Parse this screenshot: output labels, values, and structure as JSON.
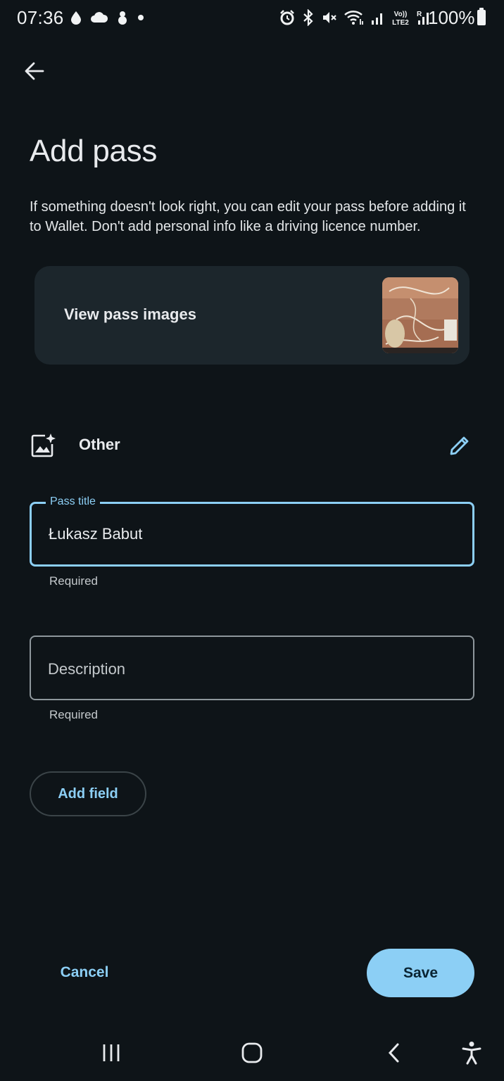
{
  "status_bar": {
    "time": "07:36",
    "battery": "100%",
    "left_icons": [
      "notification-drop-icon",
      "cloud-icon",
      "snowman-icon",
      "dot-icon"
    ],
    "right_icons": [
      "alarm-icon",
      "bluetooth-icon",
      "mute-icon",
      "wifi-icon",
      "signal-icon",
      "volte-icon",
      "signal-roaming-icon"
    ]
  },
  "header": {
    "back_icon": "arrow-back-icon",
    "title": "Add pass"
  },
  "intro": "If something doesn't look right, you can edit your pass before adding it to Wallet. Don't add personal info like a driving licence number.",
  "images_card": {
    "label": "View pass images"
  },
  "pass_type": {
    "label": "Other",
    "icon": "image-sparkle-icon",
    "edit_icon": "pencil-icon"
  },
  "fields": {
    "title": {
      "label": "Pass title",
      "value": "Łukasz Babut",
      "helper": "Required"
    },
    "description": {
      "placeholder": "Description",
      "value": "",
      "helper": "Required"
    }
  },
  "add_field_label": "Add field",
  "actions": {
    "cancel": "Cancel",
    "save": "Save"
  },
  "colors": {
    "background": "#0e1418",
    "card": "#1c262c",
    "accent": "#8ccff5",
    "outline": "#8e979c"
  }
}
